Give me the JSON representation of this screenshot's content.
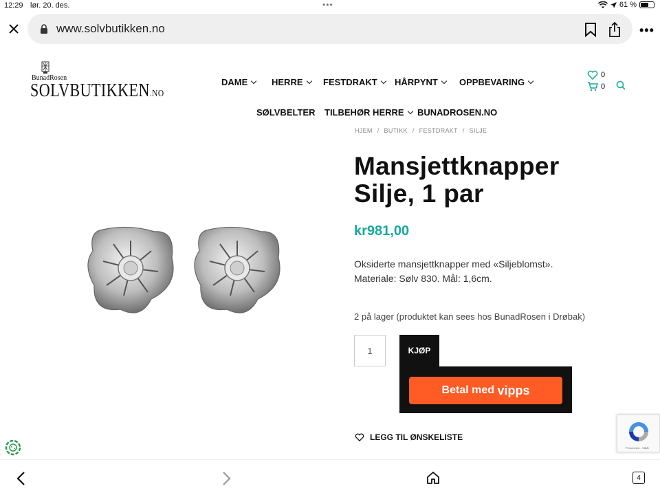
{
  "status": {
    "time": "12:29",
    "date": "lør. 20. des.",
    "battery_pct": "61 %",
    "battery_level": 0.61
  },
  "browser": {
    "url": "www.solvbutikken.no",
    "tab_count": "4"
  },
  "logo": {
    "small": "BunadRosen",
    "big": "SOLVBUTIKKEN",
    "suffix": ".NO"
  },
  "nav": {
    "row1": [
      "DAME",
      "HERRE",
      "FESTDRAKT",
      "HÅRPYNT",
      "OPPBEVARING"
    ],
    "row2": [
      "SØLVBELTER",
      "TILBEHØR HERRE",
      "BUNADROSEN.NO"
    ]
  },
  "header_icons": {
    "wishlist_count": "0",
    "cart_count": "0"
  },
  "breadcrumb": [
    "HJEM",
    "BUTIKK",
    "FESTDRAKT",
    "SILJE"
  ],
  "product": {
    "title": "Mansjettknapper Silje, 1 par",
    "price": "kr981,00",
    "description_line1": "Oksiderte mansjettknapper med «Siljeblomst».",
    "description_line2": "Materiale: Sølv 830. Mål: 1,6cm.",
    "stock": "2 på lager (produktet kan sees hos BunadRosen i Drøbak)",
    "quantity": "1",
    "buy_label": "KJØP",
    "vipps_label": "Betal med",
    "vipps_brand": "vipps",
    "wishlist_label": "LEGG TIL ØNSKELISTE"
  },
  "recaptcha": {
    "text": "Personvern - Vilkår"
  },
  "colors": {
    "accent": "#17a99b",
    "vipps": "#ff5b24",
    "dark": "#111111"
  }
}
